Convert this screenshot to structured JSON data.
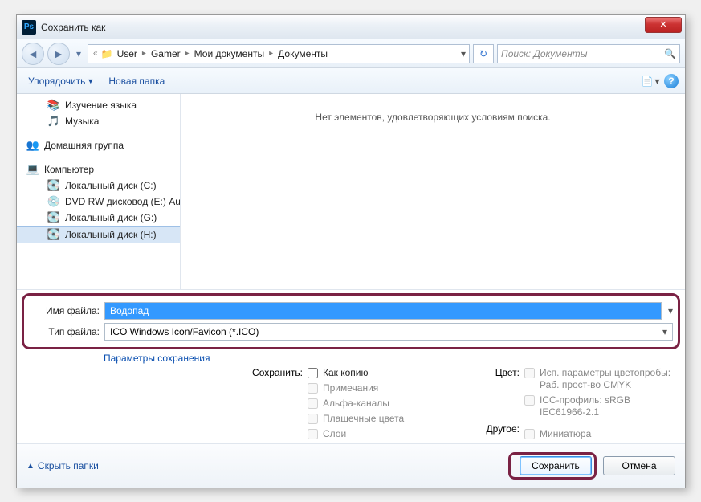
{
  "titlebar": {
    "title": "Сохранить как",
    "app_icon": "Ps"
  },
  "nav": {
    "back_glyph": "«",
    "breadcrumb": [
      "User",
      "Gamer",
      "Мои документы",
      "Документы"
    ],
    "search_placeholder": "Поиск: Документы",
    "refresh_glyph": "↻"
  },
  "toolbar": {
    "organize": "Упорядочить",
    "new_folder": "Новая папка"
  },
  "sidebar": {
    "items_top": [
      {
        "icon": "📚",
        "label": "Изучение языка"
      },
      {
        "icon": "🎵",
        "label": "Музыка"
      }
    ],
    "homegroup": {
      "icon": "👥",
      "label": "Домашняя группа"
    },
    "computer": {
      "icon": "💻",
      "label": "Компьютер",
      "drives": [
        {
          "icon": "💽",
          "label": "Локальный диск (C:)"
        },
        {
          "icon": "💿",
          "label": "DVD RW дисковод (E:) Au"
        },
        {
          "icon": "💽",
          "label": "Локальный диск (G:)"
        },
        {
          "icon": "💽",
          "label": "Локальный диск (H:)",
          "selected": true
        }
      ]
    }
  },
  "content": {
    "empty_text": "Нет элементов, удовлетворяющих условиям поиска."
  },
  "fields": {
    "filename_label": "Имя файла:",
    "filename_value": "Водопад",
    "filetype_label": "Тип файла:",
    "filetype_value": "ICO Windows Icon/Favicon (*.ICO)",
    "save_params": "Параметры сохранения"
  },
  "options": {
    "save_label": "Сохранить:",
    "checks": [
      {
        "label": "Как копию",
        "enabled": true
      },
      {
        "label": "Примечания",
        "enabled": false
      },
      {
        "label": "Альфа-каналы",
        "enabled": false
      },
      {
        "label": "Плашечные цвета",
        "enabled": false
      },
      {
        "label": "Слои",
        "enabled": false
      }
    ],
    "color_label": "Цвет:",
    "color_checks": [
      {
        "label": "Исп. параметры цветопробы: Раб. прост-во CMYK",
        "enabled": false
      },
      {
        "label": "ICC-профиль: sRGB IEC61966-2.1",
        "enabled": false
      }
    ],
    "other_label": "Другое:",
    "other_check": {
      "label": "Миниатюра",
      "enabled": false
    }
  },
  "footer": {
    "hide_folders": "Скрыть папки",
    "save": "Сохранить",
    "cancel": "Отмена"
  }
}
